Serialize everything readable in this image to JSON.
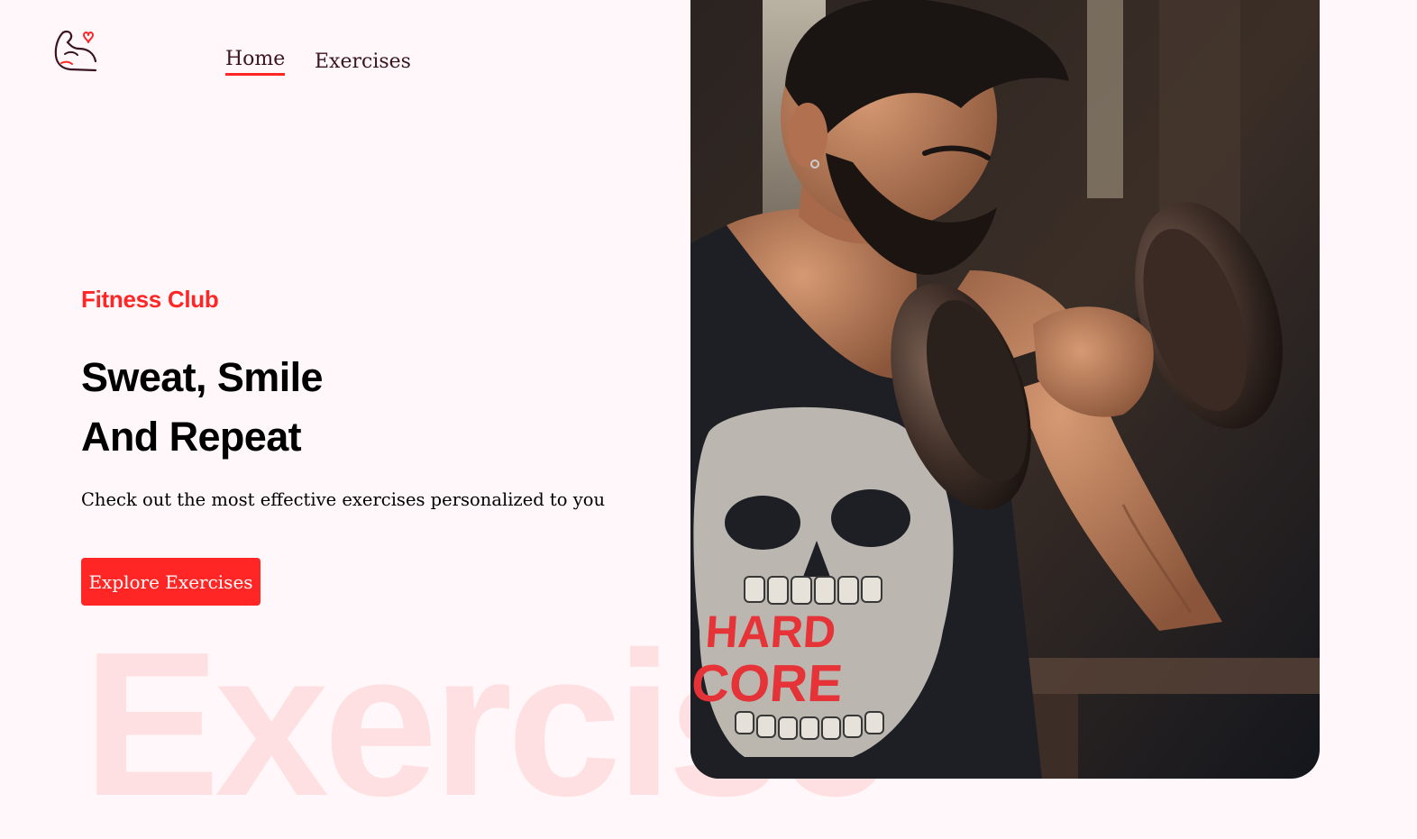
{
  "nav": {
    "logo_icon": "flexed-bicep-heart-icon",
    "links": [
      {
        "label": "Home",
        "active": true
      },
      {
        "label": "Exercises",
        "active": false
      }
    ]
  },
  "hero": {
    "eyebrow": "Fitness Club",
    "headline_line1": "Sweat, Smile",
    "headline_line2": "And Repeat",
    "subtitle": "Check out the most effective exercises personalized to you",
    "cta_label": "Explore Exercises",
    "background_word": "Exercise",
    "image_shirt_text_line1": "HARD",
    "image_shirt_text_line2": "CORE"
  },
  "colors": {
    "accent": "#ff2625",
    "background": "#fff7f9",
    "nav_text": "#3a1520"
  }
}
